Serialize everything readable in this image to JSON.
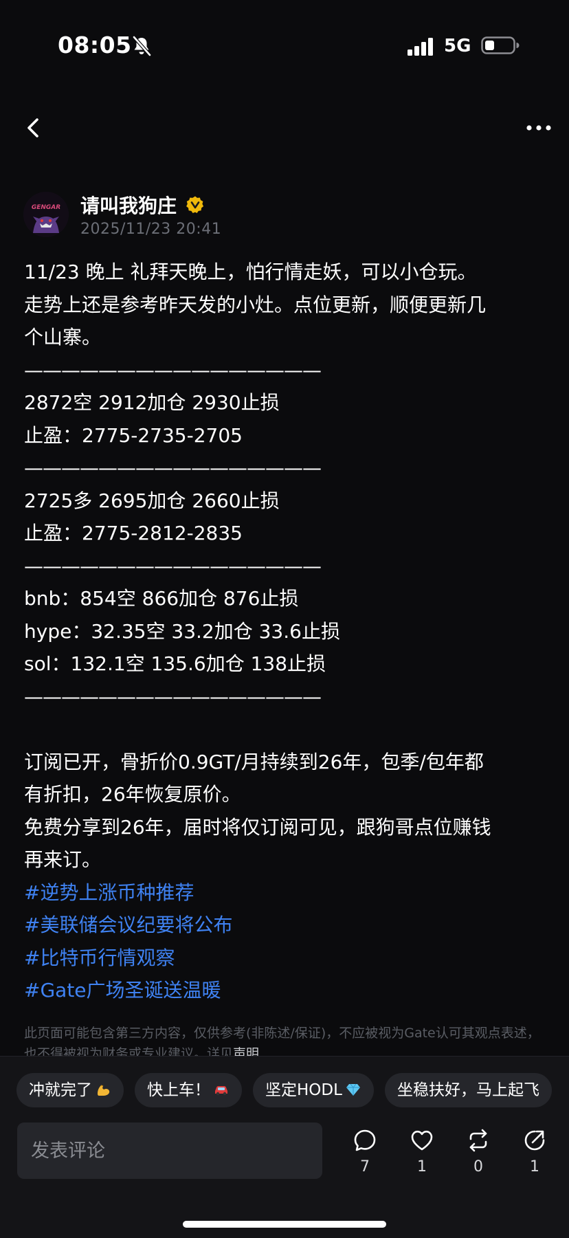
{
  "status_bar": {
    "time": "08:05",
    "network": "5G",
    "icons": [
      "bell-off-icon",
      "signal-icon",
      "battery-icon"
    ]
  },
  "nav": {
    "icons": [
      "back-icon",
      "more-icon"
    ]
  },
  "author": {
    "name": "请叫我狗庄",
    "avatar_text": "GENGAR",
    "timestamp": "2025/11/23 20:41",
    "verified_color": "#f0b90b"
  },
  "post": {
    "intro": [
      "11/23  晚上  礼拜天晚上，怕行情走妖，可以小仓玩。",
      "走势上还是参考昨天发的小灶。点位更新，顺便更新几",
      "个山寨。"
    ],
    "separator": "————————————————",
    "eth_short": [
      "2872空 2912加仓 2930止损",
      "止盈：2775-2735-2705"
    ],
    "eth_long": [
      "2725多 2695加仓 2660止损",
      "止盈：2775-2812-2835"
    ],
    "alts": [
      "bnb：854空 866加仓 876止损",
      "hype：32.35空  33.2加仓 33.6止损",
      "sol：132.1空  135.6加仓 138止损"
    ],
    "outro": [
      "订阅已开，骨折价0.9GT/月持续到26年，包季/包年都",
      "有折扣，26年恢复原价。",
      "免费分享到26年，届时将仅订阅可见，跟狗哥点位赚钱",
      "再来订。"
    ],
    "hashtags": [
      "#逆势上涨币种推荐",
      "#美联储会议纪要将公布",
      "#比特币行情观察",
      "#Gate广场圣诞送温暖"
    ],
    "hashtag_color": "#3f82f2"
  },
  "disclaimer": {
    "text": "此页面可能包含第三方内容，仅供参考(非陈述/保证)，不应被视为Gate认可其观点表述，也不得被视为财务或专业建议。详见",
    "link": "声明"
  },
  "quick_replies": [
    "冲就完了",
    "快上车！",
    "坚定HODL",
    "坐稳扶好，马上起飞"
  ],
  "quick_reply_emojis": [
    "flexed-biceps-icon",
    "car-icon",
    "gem-icon"
  ],
  "comment": {
    "placeholder": "发表评论"
  },
  "actions": {
    "comment_count": "7",
    "like_count": "1",
    "repost_count": "0",
    "share_count": "1"
  }
}
